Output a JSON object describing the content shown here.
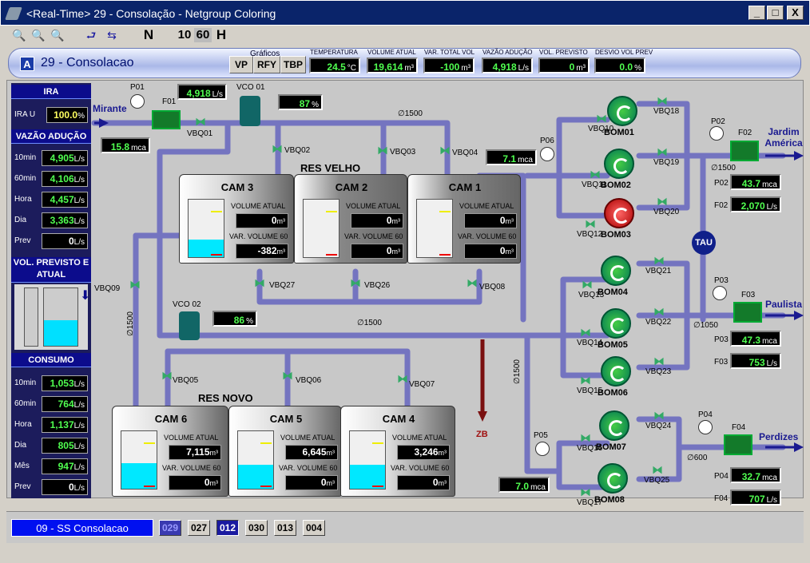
{
  "window": {
    "title": "<Real-Time> 29 - Consolação - Netgroup Coloring",
    "min": "_",
    "max": "□",
    "close": "X"
  },
  "toolbar": {
    "zoom_out": "🔍",
    "zoom_fit": "🔍",
    "zoom_in": "🔍",
    "back": "⮐",
    "nav": "⇆",
    "n": "N",
    "ten": "10",
    "sixty": "60",
    "h": "H"
  },
  "header": {
    "badge": "A",
    "title": "29 - Consolacao",
    "graficos_label": "Gráficos",
    "buttons": [
      "VP",
      "RFY",
      "TBP"
    ],
    "metrics": [
      {
        "label": "TEMPERATURA",
        "value": "24.5",
        "unit": "°C"
      },
      {
        "label": "VOLUME ATUAL",
        "value": "19,614",
        "unit": "m³"
      },
      {
        "label": "VAR. TOTAL VOL",
        "value": "-100",
        "unit": "m³"
      },
      {
        "label": "VAZÃO ADUÇÃO",
        "value": "4,918",
        "unit": "L/s"
      },
      {
        "label": "VOL. PREVISTO",
        "value": "0",
        "unit": "m³"
      },
      {
        "label": "DESVIO VOL PREV",
        "value": "0.0",
        "unit": "%"
      }
    ]
  },
  "left": {
    "ira_title": "IRA",
    "ira_label": "IRA U",
    "ira_value": "100.0",
    "ira_unit": "%",
    "vazao_title": "VAZÃO ADUÇÃO",
    "vazao": [
      {
        "label": "10min",
        "value": "4,905",
        "unit": "L/s"
      },
      {
        "label": "60min",
        "value": "4,106",
        "unit": "L/s"
      },
      {
        "label": "Hora",
        "value": "4,457",
        "unit": "L/s"
      },
      {
        "label": "Dia",
        "value": "3,363",
        "unit": "L/s"
      },
      {
        "label": "Prev",
        "value": "0",
        "unit": "L/s"
      }
    ],
    "vol_title": "VOL. PREVISTO E ATUAL",
    "vol_level": 0.45,
    "consumo_title": "CONSUMO",
    "consumo": [
      {
        "label": "10min",
        "value": "1,053",
        "unit": "L/s"
      },
      {
        "label": "60min",
        "value": "764",
        "unit": "L/s"
      },
      {
        "label": "Hora",
        "value": "1,137",
        "unit": "L/s"
      },
      {
        "label": "Dia",
        "value": "805",
        "unit": "L/s"
      },
      {
        "label": "Mês",
        "value": "947",
        "unit": "L/s"
      },
      {
        "label": "Prev",
        "value": "0",
        "unit": "L/s"
      }
    ]
  },
  "scada": {
    "mirante": "Mirante",
    "p01": "P01",
    "f01": "F01",
    "f01_val": "4,918",
    "f01_unit": "L/s",
    "p01_val": "15.8",
    "p01_unit": "mca",
    "vco01": "VCO 01",
    "vco01_val": "87",
    "vco01_unit": "%",
    "vbq01": "VBQ01",
    "d1500a": "∅1500",
    "vbq02": "VBQ02",
    "vbq03": "VBQ03",
    "vbq04": "VBQ04",
    "res_velho": "RES VELHO",
    "res_novo": "RES NOVO",
    "p06": "P06",
    "p06_val": "7.1",
    "p06_unit": "mca",
    "tanks": [
      {
        "name": "CAM 3",
        "va_label": "VOLUME ATUAL",
        "va": "0",
        "var_label": "VAR. VOLUME 60",
        "var": "-382",
        "unit": "m³",
        "level": 0.3
      },
      {
        "name": "CAM 2",
        "va_label": "VOLUME ATUAL",
        "va": "0",
        "var_label": "VAR. VOLUME 60",
        "var": "0",
        "unit": "m³",
        "level": 0
      },
      {
        "name": "CAM 1",
        "va_label": "VOLUME ATUAL",
        "va": "0",
        "var_label": "VAR. VOLUME 60",
        "var": "0",
        "unit": "m³",
        "level": 0
      },
      {
        "name": "CAM 6",
        "va_label": "VOLUME ATUAL",
        "va": "7,115",
        "var_label": "VAR. VOLUME 60",
        "var": "0",
        "unit": "m³",
        "level": 0.45
      },
      {
        "name": "CAM 5",
        "va_label": "VOLUME ATUAL",
        "va": "6,645",
        "var_label": "VAR. VOLUME 60",
        "var": "0",
        "unit": "m³",
        "level": 0.42
      },
      {
        "name": "CAM 4",
        "va_label": "VOLUME ATUAL",
        "va": "3,246",
        "var_label": "VAR. VOLUME 60",
        "var": "0",
        "unit": "m³",
        "level": 0.42
      }
    ],
    "vbq27": "VBQ27",
    "vbq26": "VBQ26",
    "vbq08": "VBQ08",
    "vbq09": "VBQ09",
    "vco02": "VCO 02",
    "vco02_val": "86",
    "vco02_unit": "%",
    "d1500b": "∅1500",
    "d1500c": "∅1500",
    "d1500d": "∅1500",
    "vbq05": "VBQ05",
    "vbq06": "VBQ06",
    "vbq07": "VBQ07",
    "zb": "ZB",
    "pumps": [
      "BOM01",
      "BOM02",
      "BOM03",
      "BOM04",
      "BOM05",
      "BOM06",
      "BOM07",
      "BOM08"
    ],
    "valves_r": [
      "VBQ10",
      "VBQ18",
      "VBQ11",
      "VBQ19",
      "VBQ12",
      "VBQ20",
      "VBQ21",
      "VBQ13",
      "VBQ22",
      "VBQ14",
      "VBQ23",
      "VBQ15",
      "VBQ24",
      "VBQ16",
      "VBQ25",
      "VBQ17"
    ],
    "tau": "TAU",
    "p02": "P02",
    "f02": "F02",
    "jardim": "Jardim América",
    "d1500e": "∅1500",
    "p02_val": "43.7",
    "p02_unit": "mca",
    "f02_val": "2,070",
    "f02_unit": "L/s",
    "p03": "P03",
    "f03": "F03",
    "paulista": "Paulista",
    "d1050": "∅1050",
    "p03_val": "47.3",
    "p03_unit": "mca",
    "f03_val": "753",
    "f03_unit": "L/s",
    "p05": "P05",
    "p05_val": "7.0",
    "p05_unit": "mca",
    "p04": "P04",
    "f04": "F04",
    "perdizes": "Perdizes",
    "d600": "∅600",
    "p04_val": "32.7",
    "p04_unit": "mca",
    "f04_val": "707",
    "f04_unit": "L/s"
  },
  "status": {
    "station": "09 - SS Consolacao",
    "tabs": [
      "029",
      "027",
      "012",
      "030",
      "013",
      "004"
    ]
  }
}
